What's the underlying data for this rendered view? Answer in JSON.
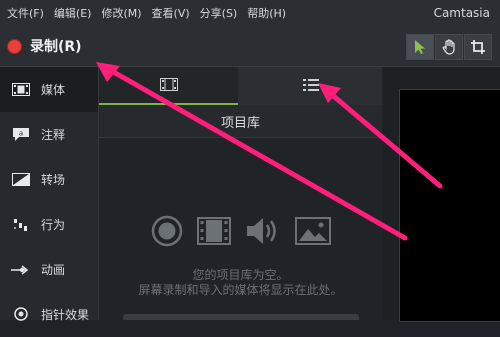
{
  "menubar": {
    "items": [
      "文件(F)",
      "编辑(E)",
      "修改(M)",
      "查看(V)",
      "分享(S)",
      "帮助(H)"
    ],
    "app_title": "Camtasia"
  },
  "toolbar": {
    "record_label": "录制(R)",
    "tools": [
      "pointer-icon",
      "hand-icon",
      "crop-icon"
    ]
  },
  "sidebar": {
    "items": [
      {
        "label": "媒体",
        "icon": "media-icon",
        "active": true
      },
      {
        "label": "注释",
        "icon": "annotation-icon"
      },
      {
        "label": "转场",
        "icon": "transition-icon"
      },
      {
        "label": "行为",
        "icon": "behavior-icon"
      },
      {
        "label": "动画",
        "icon": "animation-icon"
      },
      {
        "label": "指针效果",
        "icon": "cursor-effect-icon"
      }
    ]
  },
  "panel": {
    "tabs": [
      "film-icon",
      "list-icon"
    ],
    "header": "项目库",
    "empty_icons": [
      "record-icon",
      "film-icon",
      "audio-icon",
      "image-icon"
    ],
    "empty_line1": "您的项目库为空。",
    "empty_line2": "屏幕录制和导入的媒体将显示在此处。"
  },
  "colors": {
    "accent_green": "#7cb342",
    "record_red": "#e8403a",
    "annotation_pink": "#ff1f7a",
    "cursor_green": "#8bc34a"
  }
}
